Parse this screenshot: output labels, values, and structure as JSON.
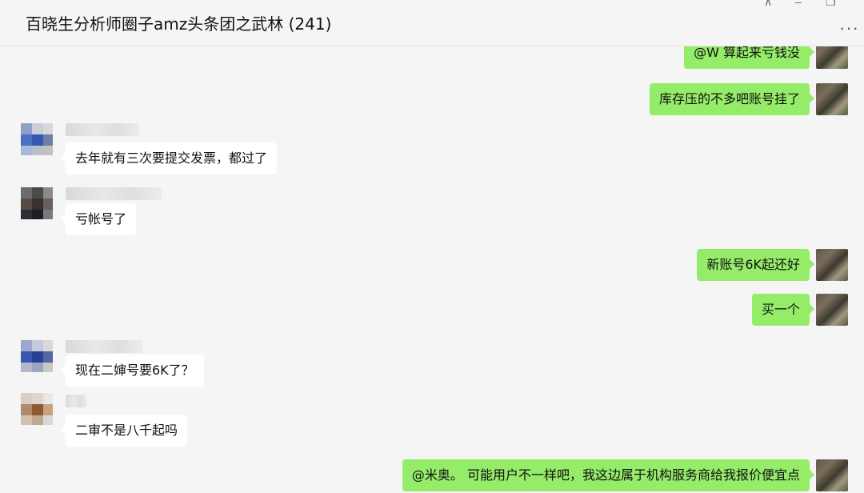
{
  "window": {
    "title": "百晓生分析师圈子amz头条团之武林 (241)",
    "controls": {
      "pin": "⊼",
      "minimize": "–",
      "restore": "❐"
    },
    "more_label": "···"
  },
  "messages": [
    {
      "side": "out",
      "text": "@W 算起来亏钱没"
    },
    {
      "side": "out",
      "text": "库存压的不多吧账号挂了"
    },
    {
      "side": "in",
      "text": "去年就有三次要提交发票，都过了"
    },
    {
      "side": "in",
      "text": "亏帐号了"
    },
    {
      "side": "out",
      "text": "新账号6K起还好"
    },
    {
      "side": "out",
      "text": "买一个"
    },
    {
      "side": "in",
      "text": "现在二婶号要6K了？"
    },
    {
      "side": "in",
      "text": "二审不是八千起吗"
    },
    {
      "side": "out",
      "text": "@米奥。 可能用户不一样吧，我这边属于机构服务商给我报价便宜点"
    }
  ],
  "colors": {
    "bubble_out": "#95ec69",
    "bubble_in": "#ffffff",
    "background": "#f5f5f5"
  }
}
